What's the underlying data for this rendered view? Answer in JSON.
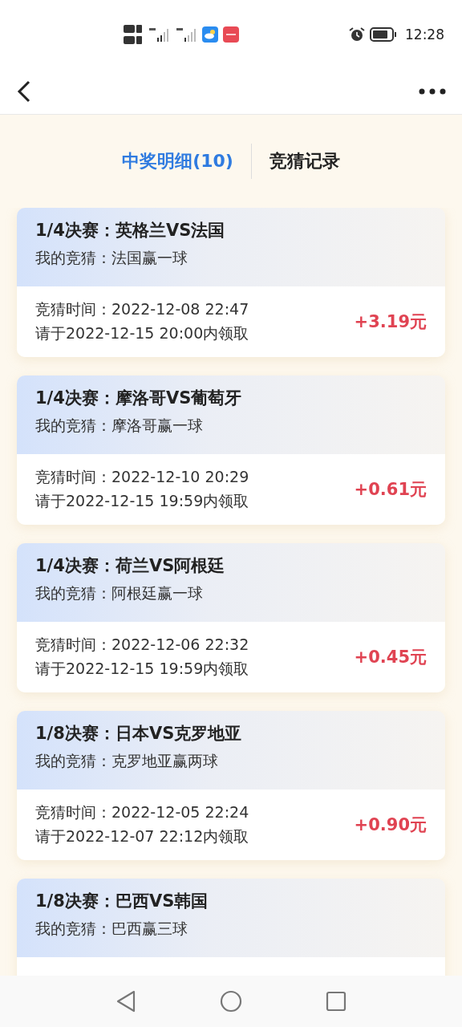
{
  "status_bar": {
    "time": "12:28"
  },
  "tabs": [
    {
      "label": "中奖明细(10)",
      "selected": true
    },
    {
      "label": "竞猜记录",
      "selected": false
    }
  ],
  "records": [
    {
      "match": "1/4决赛：英格兰VS法国",
      "my_guess": "我的竞猜：法国赢一球",
      "bet_time": "竞猜时间：2022-12-08 22:47",
      "claim_note": "请于2022-12-15 20:00内领取",
      "amount": "+3.19元"
    },
    {
      "match": "1/4决赛：摩洛哥VS葡萄牙",
      "my_guess": "我的竞猜：摩洛哥赢一球",
      "bet_time": "竞猜时间：2022-12-10 20:29",
      "claim_note": "请于2022-12-15 19:59内领取",
      "amount": "+0.61元"
    },
    {
      "match": "1/4决赛：荷兰VS阿根廷",
      "my_guess": "我的竞猜：阿根廷赢一球",
      "bet_time": "竞猜时间：2022-12-06 22:32",
      "claim_note": "请于2022-12-15 19:59内领取",
      "amount": "+0.45元"
    },
    {
      "match": "1/8决赛：日本VS克罗地亚",
      "my_guess": "我的竞猜：克罗地亚赢两球",
      "bet_time": "竞猜时间：2022-12-05 22:24",
      "claim_note": "请于2022-12-07 22:12内领取",
      "amount": "+0.90元"
    },
    {
      "match": "1/8决赛：巴西VS韩国",
      "my_guess": "我的竞猜：巴西赢三球"
    }
  ]
}
